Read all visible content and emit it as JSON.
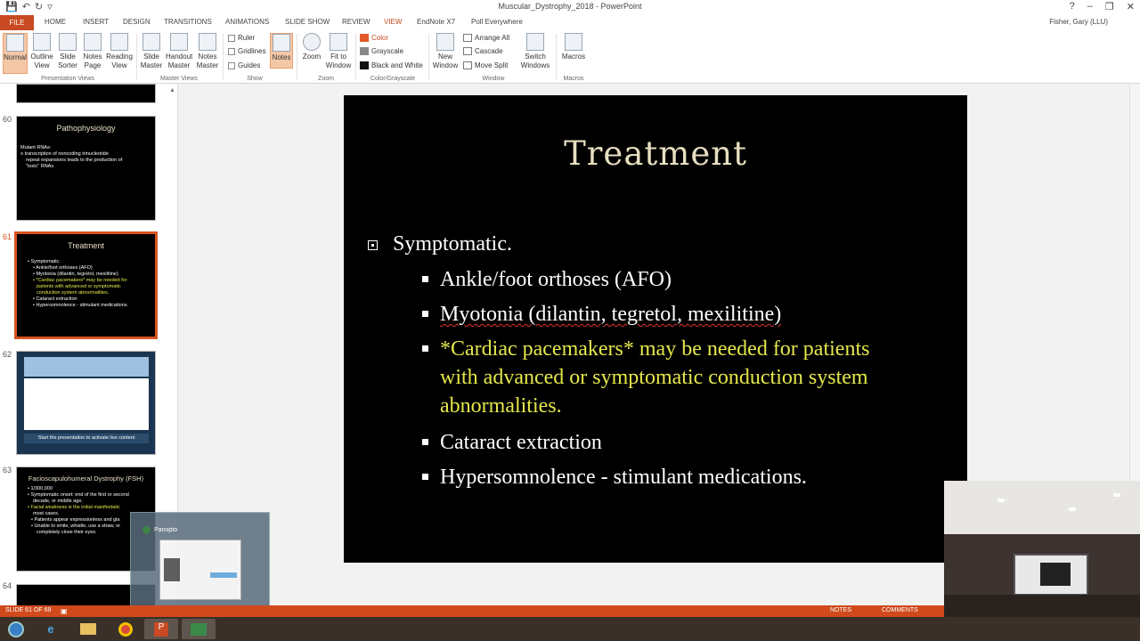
{
  "window": {
    "title": "Muscular_Dystrophy_2018 - PowerPoint",
    "help": "?",
    "min": "–",
    "restore": "❐",
    "close": "✕"
  },
  "qat": {
    "save": "💾",
    "undo": "↶",
    "redo": "↻",
    "more": "▿"
  },
  "tabs": [
    {
      "label": "FILE"
    },
    {
      "label": "HOME"
    },
    {
      "label": "INSERT"
    },
    {
      "label": "DESIGN"
    },
    {
      "label": "TRANSITIONS"
    },
    {
      "label": "ANIMATIONS"
    },
    {
      "label": "SLIDE SHOW"
    },
    {
      "label": "REVIEW"
    },
    {
      "label": "VIEW"
    },
    {
      "label": "EndNote X7"
    },
    {
      "label": "Poll Everywhere"
    }
  ],
  "user": "Fisher, Gary (LLU)",
  "ribbon": {
    "presentation_views": {
      "label": "Presentation Views",
      "buttons": [
        "Normal",
        "Outline View",
        "Slide Sorter",
        "Notes Page",
        "Reading View"
      ]
    },
    "master_views": {
      "label": "Master Views",
      "buttons": [
        "Slide Master",
        "Handout Master",
        "Notes Master"
      ]
    },
    "show": {
      "label": "Show",
      "ruler": "Ruler",
      "gridlines": "Gridlines",
      "guides": "Guides",
      "notes": "Notes"
    },
    "zoom": {
      "label": "Zoom",
      "zoom": "Zoom",
      "fit": "Fit to Window"
    },
    "color": {
      "label": "Color/Grayscale",
      "color": "Color",
      "grayscale": "Grayscale",
      "bw": "Black and White"
    },
    "window": {
      "label": "Window",
      "new_window": "New Window",
      "arrange": "Arrange All",
      "cascade": "Cascade",
      "move_split": "Move Split",
      "switch": "Switch Windows"
    },
    "macros": {
      "label": "Macros",
      "macros": "Macros"
    }
  },
  "thumbnails": [
    {
      "num": "60",
      "title": "Pathophysiology",
      "lines": [
        "Mutant RNAs:",
        "≡ transcription of noncoding trinucleotide",
        "repeat expansions leads to the production of",
        "\"toxic\" RNAs"
      ]
    },
    {
      "num": "61",
      "title": "Treatment",
      "lines": [
        "• Symptomatic.",
        "• Ankle/foot orthoses (AFO)",
        "• Myotonia (dilantin, tegretol, mexilitine)",
        "• *Cardiac pacemakers* may be needed for",
        "patients with advanced or symptomatic",
        "conduction system abnormalities.",
        "• Cataract extraction",
        "• Hypersomnolence - stimulant medications."
      ]
    },
    {
      "num": "62",
      "footer": "Start the presentation to activate live content"
    },
    {
      "num": "63",
      "title": "Facioscapulohumeral Dystrophy (FSH)",
      "lines": [
        "• 1/300,000",
        "• Symptomatic onset: end of the first or second",
        "decade, or middle age.",
        "• Facial weakness is the initial manifestatic",
        "most cases.",
        "• Patients appear expressionless and gla",
        "• Unable to smile, whistle, use a straw, or",
        "completely close their eyes."
      ]
    },
    {
      "num": "64"
    }
  ],
  "slide": {
    "title": "Treatment",
    "level1": "Symptomatic.",
    "items": [
      {
        "text": "Ankle/foot orthoses (AFO)"
      },
      {
        "text": "Myotonia (dilantin, tegretol, mexilitine)"
      },
      {
        "text": "*Cardiac pacemakers* may be needed for patients with advanced or symptomatic conduction system abnormalities."
      },
      {
        "text": "Cataract extraction"
      },
      {
        "text": "Hypersomnolence - stimulant medications."
      }
    ]
  },
  "popup": {
    "title": "Panopto"
  },
  "status": {
    "slide": "SLIDE 61 OF 69",
    "notes": "NOTES",
    "comments": "COMMENTS"
  },
  "colors": {
    "accent": "#d04a1c",
    "slide_bg": "#000000",
    "title": "#e8dfc0",
    "highlight": "#e5e84a"
  }
}
